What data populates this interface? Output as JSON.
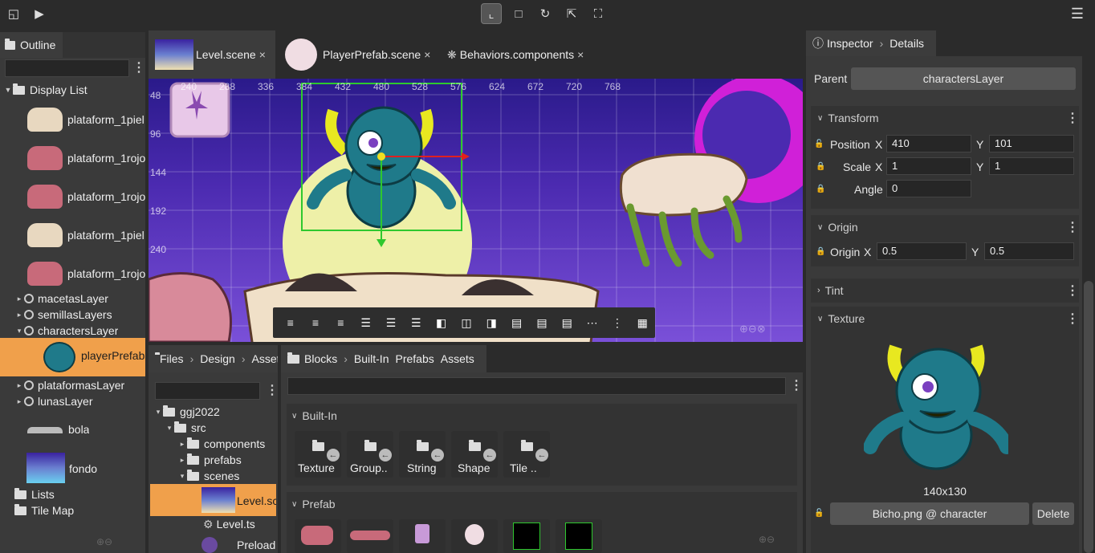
{
  "toolbar": {
    "menu_icon": "hamburger-icon"
  },
  "outline": {
    "tab_label": "Outline",
    "search_placeholder": "",
    "root_label": "Display List",
    "items": [
      {
        "label": "plataform_1piel"
      },
      {
        "label": "plataform_1rojo"
      },
      {
        "label": "plataform_1rojo"
      },
      {
        "label": "plataform_1piel"
      },
      {
        "label": "plataform_1rojo"
      }
    ],
    "layers": [
      "macetasLayer",
      "semillasLayers",
      "charactersLayer"
    ],
    "selected_child": "playerPrefab",
    "more_layers": [
      "plataformasLayer",
      "lunasLayer"
    ],
    "bola": "bola",
    "fondo": "fondo",
    "lists": "Lists",
    "tilemap": "Tile Map"
  },
  "editor": {
    "tabs": [
      {
        "label": "Level.scene"
      },
      {
        "label": "PlayerPrefab.scene"
      },
      {
        "label": "Behaviors.components"
      }
    ],
    "close_glyph": "×",
    "ruler_x": [
      "240",
      "288",
      "336",
      "384",
      "432",
      "480",
      "528",
      "576",
      "624",
      "672",
      "720",
      "768"
    ],
    "ruler_y": [
      "48",
      "96",
      "144",
      "192",
      "240"
    ]
  },
  "files": {
    "breadcrumb": [
      "Files",
      "Design",
      "Assets"
    ],
    "tree": {
      "project": "ggj2022",
      "src": "src",
      "components": "components",
      "prefabs": "prefabs",
      "scenes": "scenes",
      "level_scene": "Level.scene",
      "level_ts": "Level.ts",
      "preload": "Preload"
    }
  },
  "blocks": {
    "breadcrumb": [
      "Blocks",
      "Built-In",
      "Prefabs",
      "Assets"
    ],
    "builtin_header": "Built-In",
    "builtin": [
      "Texture",
      "Group..",
      "String",
      "Shape",
      "Tile .."
    ],
    "prefab_header": "Prefab"
  },
  "inspector": {
    "breadcrumb": [
      "Inspector",
      "Details"
    ],
    "parent_label": "Parent",
    "parent_value": "charactersLayer",
    "transform_header": "Transform",
    "position_label": "Position",
    "scale_label": "Scale",
    "angle_label": "Angle",
    "x": "X",
    "y": "Y",
    "position_x": "410",
    "position_y": "101",
    "scale_x": "1",
    "scale_y": "1",
    "angle": "0",
    "origin_header": "Origin",
    "origin_label": "Origin",
    "origin_x": "0.5",
    "origin_y": "0.5",
    "tint_header": "Tint",
    "texture_header": "Texture",
    "texture_size": "140x130",
    "texture_value": "Bicho.png @ character",
    "delete_label": "Delete"
  },
  "colors": {
    "accent": "#f0a04b",
    "selection": "#f0a04b",
    "scene_bg": "#4b2ab0",
    "gizmo": "#2ec82e"
  }
}
